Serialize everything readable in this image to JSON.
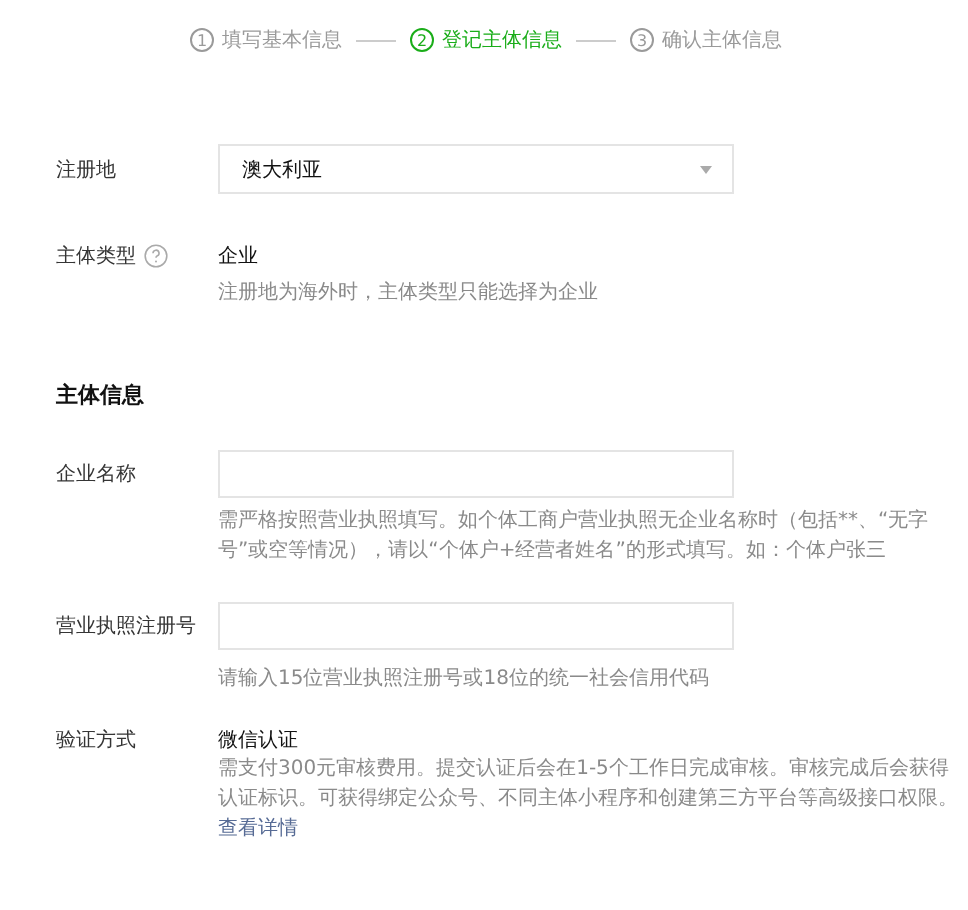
{
  "steps": [
    {
      "number": "1",
      "label": "填写基本信息",
      "selected": false
    },
    {
      "number": "2",
      "label": "登记主体信息",
      "selected": true
    },
    {
      "number": "3",
      "label": "确认主体信息",
      "selected": false
    }
  ],
  "registration_place": {
    "label": "注册地",
    "value": "澳大利亚"
  },
  "entity_type": {
    "label": "主体类型",
    "value": "企业",
    "hint": "注册地为海外时，主体类型只能选择为企业"
  },
  "section_title": "主体信息",
  "company_name": {
    "label": "企业名称",
    "hint": "需严格按照营业执照填写。如个体工商户营业执照无企业名称时（包括**、“无字号”或空等情况），请以“个体户+经营者姓名”的形式填写。如：个体户张三"
  },
  "license_number": {
    "label": "营业执照注册号",
    "hint": "请输入15位营业执照注册号或18位的统一社会信用代码"
  },
  "verification": {
    "label": "验证方式",
    "method": "微信认证",
    "description": "需支付300元审核费用。提交认证后会在1-5个工作日完成审核。审核完成后会获得认证标识。可获得绑定公众号、不同主体小程序和创建第三方平台等高级接口权限。",
    "link": "查看详情"
  }
}
